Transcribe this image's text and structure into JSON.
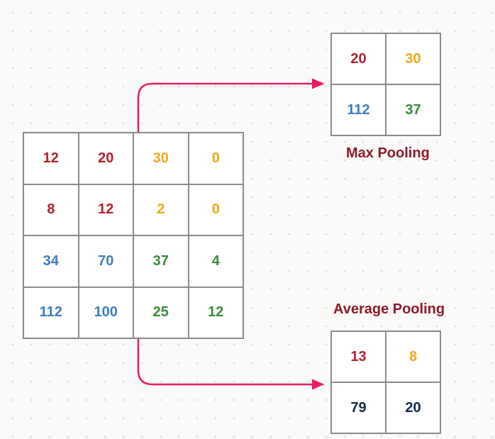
{
  "colors": {
    "red": "#b8202c",
    "orange": "#f0a916",
    "blue": "#3d7ec0",
    "green": "#3a8a3c",
    "navy": "#102a4e",
    "label": "#8e1a28"
  },
  "input_grid": {
    "rows": 4,
    "cols": 4,
    "cells": [
      [
        {
          "v": "12",
          "c": "red"
        },
        {
          "v": "20",
          "c": "red"
        },
        {
          "v": "30",
          "c": "orange"
        },
        {
          "v": "0",
          "c": "orange"
        }
      ],
      [
        {
          "v": "8",
          "c": "red"
        },
        {
          "v": "12",
          "c": "red"
        },
        {
          "v": "2",
          "c": "orange"
        },
        {
          "v": "0",
          "c": "orange"
        }
      ],
      [
        {
          "v": "34",
          "c": "blue"
        },
        {
          "v": "70",
          "c": "blue"
        },
        {
          "v": "37",
          "c": "green"
        },
        {
          "v": "4",
          "c": "green"
        }
      ],
      [
        {
          "v": "112",
          "c": "blue"
        },
        {
          "v": "100",
          "c": "blue"
        },
        {
          "v": "25",
          "c": "green"
        },
        {
          "v": "12",
          "c": "green"
        }
      ]
    ]
  },
  "max_pool": {
    "label": "Max Pooling",
    "rows": 2,
    "cols": 2,
    "cells": [
      [
        {
          "v": "20",
          "c": "red"
        },
        {
          "v": "30",
          "c": "orange"
        }
      ],
      [
        {
          "v": "112",
          "c": "blue"
        },
        {
          "v": "37",
          "c": "green"
        }
      ]
    ]
  },
  "avg_pool": {
    "label": "Average Pooling",
    "rows": 2,
    "cols": 2,
    "cells": [
      [
        {
          "v": "13",
          "c": "red"
        },
        {
          "v": "8",
          "c": "orange"
        }
      ],
      [
        {
          "v": "79",
          "c": "navy"
        },
        {
          "v": "20",
          "c": "navy"
        }
      ]
    ]
  }
}
